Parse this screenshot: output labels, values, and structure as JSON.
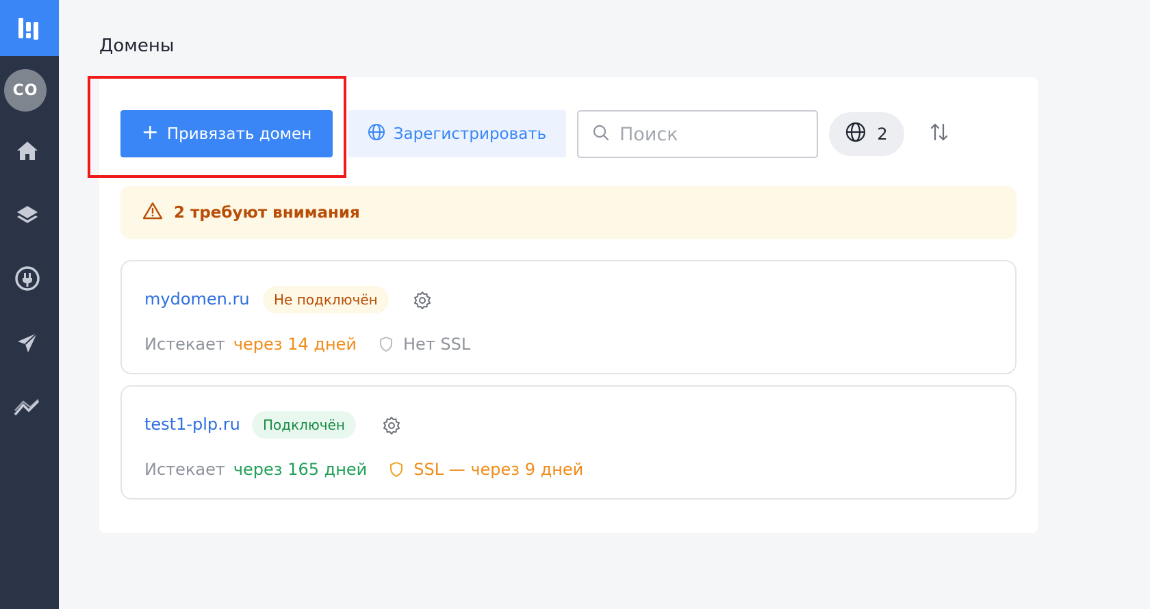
{
  "sidebar": {
    "avatar_text": "CO",
    "icons": [
      "logo-icon",
      "home-icon",
      "layers-icon",
      "plug-icon",
      "send-icon",
      "analytics-icon"
    ]
  },
  "page": {
    "title": "Домены"
  },
  "toolbar": {
    "bind_label": "Привязать домен",
    "register_label": "Зарегистрировать",
    "search_placeholder": "Поиск",
    "domain_count": "2"
  },
  "alert": {
    "text": "2 требуют внимания"
  },
  "domains": [
    {
      "name": "mydomen.ru",
      "status": "Не подключён",
      "expires_label": "Истекает",
      "expires_value": "через 14 дней",
      "ssl_text": "Нет SSL"
    },
    {
      "name": "test1-plp.ru",
      "status": "Подключён",
      "expires_label": "Истекает",
      "expires_value": "через 165 дней",
      "ssl_text": "SSL — через 9 дней"
    }
  ],
  "colors": {
    "accent": "#3a86f7",
    "sidebar": "#2b3347",
    "warning": "#b84e06",
    "success": "#1b8a46",
    "highlight": "#f01a1a"
  }
}
